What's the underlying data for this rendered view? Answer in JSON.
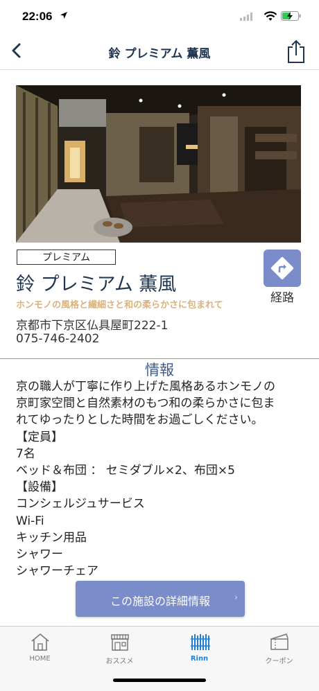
{
  "status_bar": {
    "time": "22:06"
  },
  "nav": {
    "title": "鈴 プレミアム 薫風"
  },
  "facility": {
    "badge": "プレミアム",
    "name": "鈴 プレミアム 薫風",
    "tagline": "ホンモノの風格と繊細さと和の柔らかさに包まれて",
    "address": "京都市下京区仏具屋町222-1",
    "phone": "075-746-2402",
    "route_label": "経路"
  },
  "info": {
    "heading": "情報",
    "lines": [
      "京の職人が丁寧に作り上げた風格あるホンモノの",
      "京町家空間と自然素材のもつ和の柔らかさに包ま",
      "れてゆったりとした時間をお過ごしください。",
      "【定員】",
      "7名",
      "ベッド＆布団 ： セミダブル×2、布団×5",
      "【設備】",
      "コンシェルジュサービス",
      "Wi-Fi",
      "キッチン用品",
      "シャワー",
      "シャワーチェア"
    ]
  },
  "detail_button": {
    "label": "この施設の詳細情報",
    "chevron": "›"
  },
  "tabs": [
    {
      "label": "HOME",
      "icon": "home-icon"
    },
    {
      "label": "おススメ",
      "icon": "shop-icon"
    },
    {
      "label": "Rinn",
      "icon": "fence-icon"
    },
    {
      "label": "クーポン",
      "icon": "coupon-icon"
    }
  ],
  "colors": {
    "accent": "#7a8cc9",
    "title": "#1f3550",
    "tagline": "#d9b27c",
    "active_tab": "#1e7fd6"
  }
}
